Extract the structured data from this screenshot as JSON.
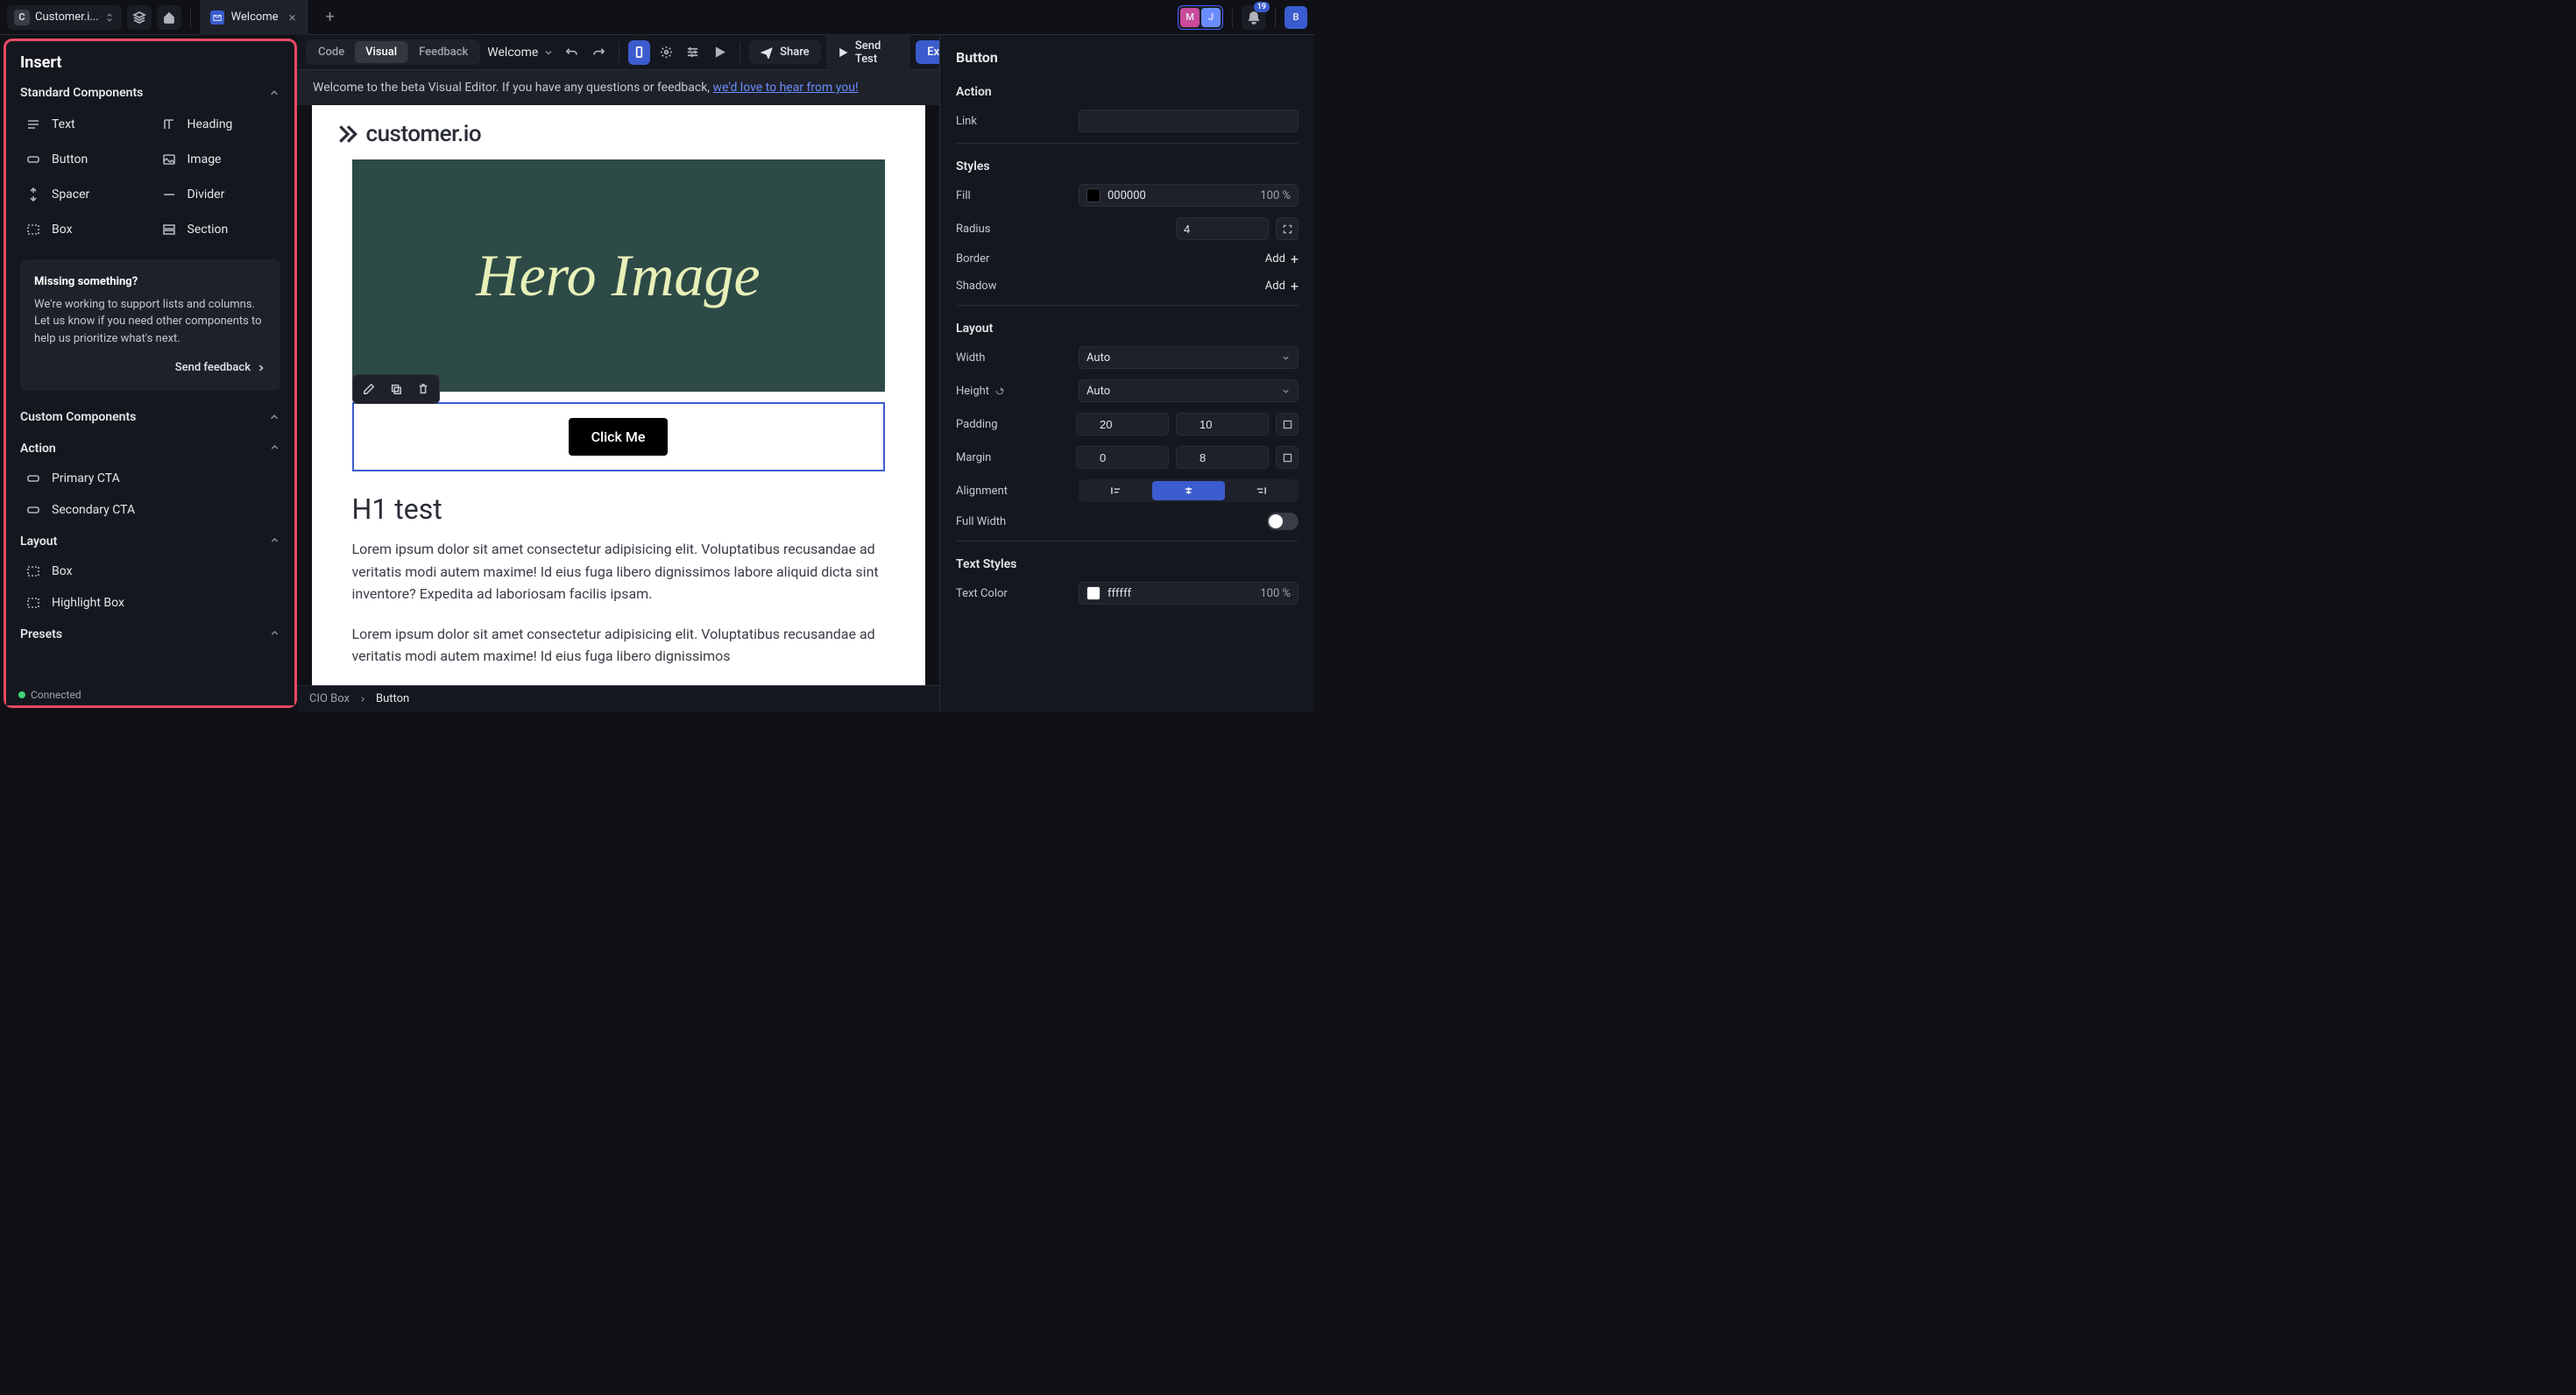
{
  "topbar": {
    "project_letter": "C",
    "project_name": "Customer.i...",
    "tab_title": "Welcome",
    "avatars": [
      {
        "letter": "M",
        "bg": "#c94a9a"
      },
      {
        "letter": "J",
        "bg": "#6a8cff"
      }
    ],
    "badge": "19",
    "user_avatar": {
      "letter": "B",
      "bg": "#3b5cce"
    }
  },
  "left": {
    "title": "Insert",
    "section_standard": "Standard Components",
    "items": [
      "Text",
      "Heading",
      "Button",
      "Image",
      "Spacer",
      "Divider",
      "Box",
      "Section"
    ],
    "info_title": "Missing something?",
    "info_body": "We're working to support lists and columns. Let us know if you need other components to help us prioritize what's next.",
    "info_link": "Send feedback",
    "section_custom": "Custom Components",
    "sub_action": "Action",
    "custom_action": [
      "Primary CTA",
      "Secondary CTA"
    ],
    "sub_layout": "Layout",
    "custom_layout": [
      "Box",
      "Highlight Box"
    ],
    "sub_presets": "Presets",
    "status": "Connected"
  },
  "canvas_tb": {
    "modes": [
      "Code",
      "Visual",
      "Feedback"
    ],
    "active_mode": 1,
    "doc_name": "Welcome",
    "share": "Share",
    "send_test": "Send Test",
    "export": "Export"
  },
  "banner": {
    "text": "Welcome to the beta Visual Editor. If you have any questions or feedback, ",
    "link": "we'd love to hear from you!"
  },
  "email": {
    "logo_text": "customer.io",
    "hero_text": "Hero Image",
    "cta_label": "Click Me",
    "h1": "H1 test",
    "p1": "Lorem ipsum dolor sit amet consectetur adipisicing elit. Voluptatibus recusandae ad veritatis modi autem maxime! Id eius fuga libero dignissimos labore aliquid dicta sint inventore? Expedita ad laboriosam facilis ipsam.",
    "p2": "Lorem ipsum dolor sit amet consectetur adipisicing elit. Voluptatibus recusandae ad veritatis modi autem maxime! Id eius fuga libero dignissimos"
  },
  "breadcrumb": {
    "a": "CIO Box",
    "b": "Button"
  },
  "right": {
    "title": "Button",
    "action_h": "Action",
    "link_label": "Link",
    "styles_h": "Styles",
    "fill_label": "Fill",
    "fill_value": "000000",
    "fill_opacity": "100 %",
    "radius_label": "Radius",
    "radius_value": "4",
    "border_label": "Border",
    "shadow_label": "Shadow",
    "add": "Add",
    "layout_h": "Layout",
    "width_label": "Width",
    "width_value": "Auto",
    "height_label": "Height",
    "height_value": "Auto",
    "padding_label": "Padding",
    "padding_h": "20",
    "padding_v": "10",
    "margin_label": "Margin",
    "margin_h": "0",
    "margin_v": "8",
    "alignment_label": "Alignment",
    "fullwidth_label": "Full Width",
    "textstyles_h": "Text Styles",
    "textcolor_label": "Text Color",
    "textcolor_value": "ffffff",
    "textcolor_opacity": "100 %"
  }
}
